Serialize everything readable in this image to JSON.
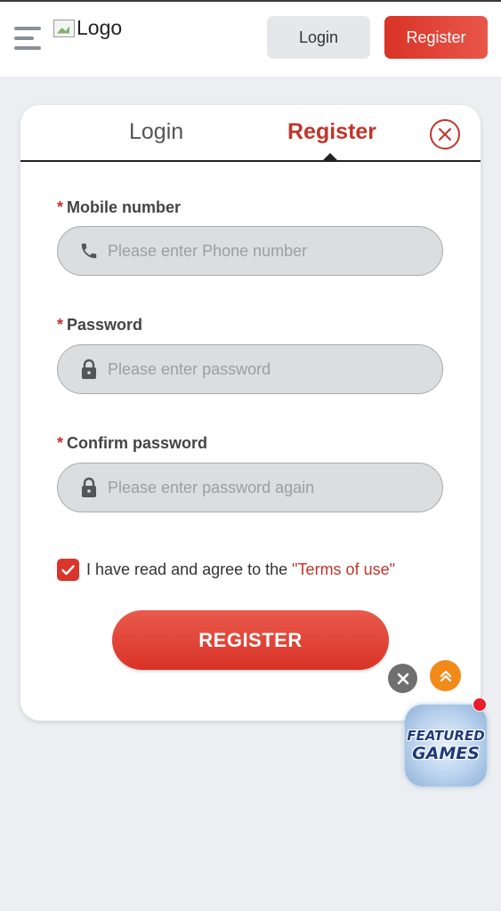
{
  "header": {
    "logo_text": "Logo",
    "login_label": "Login",
    "register_label": "Register",
    "menu_icon": "hamburger-menu-icon"
  },
  "tabs": {
    "login_label": "Login",
    "register_label": "Register",
    "active": "Register"
  },
  "form": {
    "mobile": {
      "required_mark": "*",
      "label": "Mobile number",
      "placeholder": "Please enter Phone number",
      "value": "",
      "icon": "phone-icon"
    },
    "password": {
      "required_mark": "*",
      "label": "Password",
      "placeholder": "Please enter password",
      "value": "",
      "icon": "lock-icon"
    },
    "confirm_password": {
      "required_mark": "*",
      "label": "Confirm password",
      "placeholder": "Please enter password again",
      "value": "",
      "icon": "lock-icon"
    },
    "agree_text": "I have read and agree to the",
    "terms_link": "\"Terms of use\"",
    "agree_checked": true,
    "submit_label": "REGISTER"
  },
  "floating": {
    "featured_line1": "FEATURED",
    "featured_line2": "GAMES"
  },
  "colors": {
    "accent": "#d83326",
    "accent_text": "#c1352b",
    "scroll_top": "#f28a1a",
    "background": "#eceef1"
  }
}
